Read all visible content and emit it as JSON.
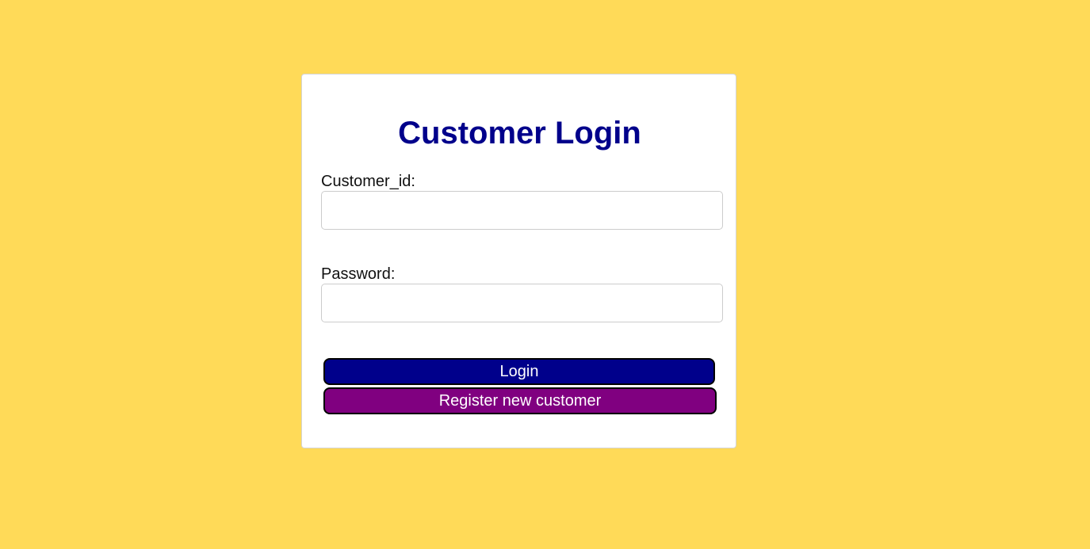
{
  "login_form": {
    "title": "Customer Login",
    "customer_id_label": "Customer_id:",
    "customer_id_value": "",
    "password_label": "Password:",
    "password_value": "",
    "login_button": "Login",
    "register_button": "Register new customer"
  },
  "colors": {
    "background": "#FFDA58",
    "title": "#00008B",
    "login_button": "#00008B",
    "register_button": "#800080"
  }
}
